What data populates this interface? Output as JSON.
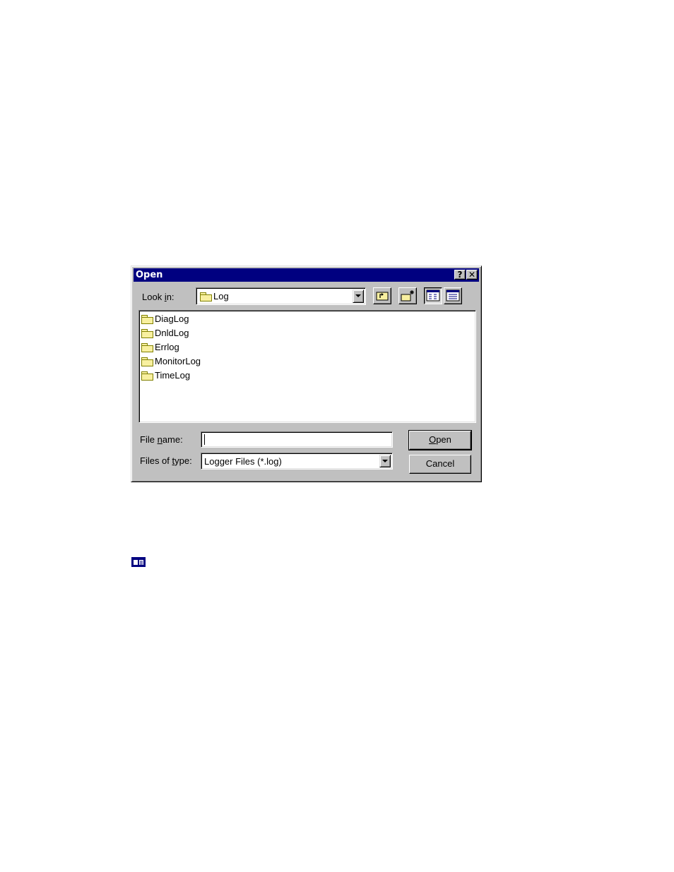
{
  "dialog": {
    "title": "Open",
    "help_glyph": "?",
    "close_glyph": "✕",
    "look_in": {
      "label_pre": "Look ",
      "label_ul": "i",
      "label_post": "n:",
      "value": "Log"
    },
    "toolbar": [
      "up-one-level-icon",
      "create-new-folder-icon",
      "list-view-icon",
      "details-view-icon"
    ],
    "files": [
      "DiagLog",
      "DnldLog",
      "Errlog",
      "MonitorLog",
      "TimeLog"
    ],
    "file_name": {
      "label_pre": "File ",
      "label_ul": "n",
      "label_post": "ame:",
      "value": ""
    },
    "file_type": {
      "label_pre": "Files of ",
      "label_ul": "t",
      "label_post": "ype:",
      "value": "Logger Files (*.log)"
    },
    "open_button": {
      "ul": "O",
      "rest": "pen"
    },
    "cancel_button": "Cancel"
  }
}
